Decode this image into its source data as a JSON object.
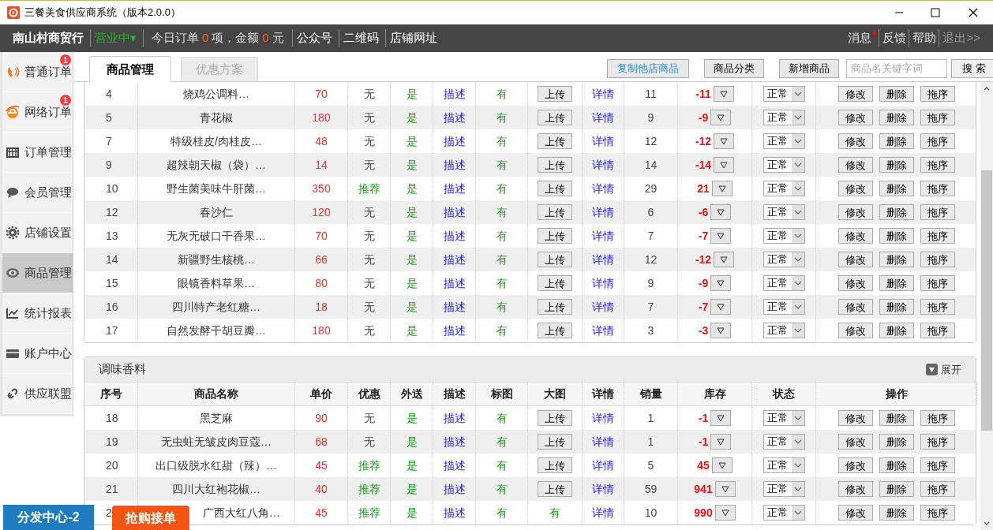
{
  "window": {
    "title": "三餐美食供应商系统（版本2.0.0）"
  },
  "header": {
    "shop": "南山村商贸行",
    "business_status": "营业中▾",
    "stats": [
      {
        "text": "今日订单",
        "kind": "label"
      },
      {
        "text": "0",
        "kind": "number"
      },
      {
        "text": "项，金额",
        "kind": "label"
      },
      {
        "text": "0",
        "kind": "number"
      },
      {
        "text": "元",
        "kind": "label"
      }
    ],
    "links": [
      "公众号",
      "二维码",
      "店铺网址"
    ],
    "right_links": [
      {
        "label": "消息",
        "unread": true,
        "muted": false
      },
      {
        "label": "反馈",
        "unread": false,
        "muted": false
      },
      {
        "label": "帮助",
        "unread": false,
        "muted": false
      },
      {
        "label": "退出>>",
        "unread": false,
        "muted": true
      }
    ]
  },
  "sidebar": {
    "items": [
      {
        "label": "普通订单",
        "badge": "1",
        "selected": false
      },
      {
        "label": "网络订单",
        "badge": "1",
        "selected": false
      },
      {
        "label": "订单管理",
        "selected": false
      },
      {
        "label": "会员管理",
        "selected": false
      },
      {
        "label": "店铺设置",
        "selected": false
      },
      {
        "label": "商品管理",
        "selected": true
      },
      {
        "label": "统计报表",
        "selected": false
      },
      {
        "label": "账户中心",
        "selected": false
      },
      {
        "label": "供应联盟",
        "selected": false
      }
    ]
  },
  "tabs": [
    {
      "label": "商品管理",
      "selected": true
    },
    {
      "label": "优惠方案",
      "selected": false
    }
  ],
  "toolbar": {
    "buttons": [
      {
        "label": "复制他店商品",
        "kind": "highlight"
      },
      {
        "label": "商品分类",
        "kind": "plain"
      },
      {
        "label": "新增商品",
        "kind": "plain"
      }
    ],
    "search": {
      "placeholder": "商品名关键字词"
    },
    "search_button": "搜 索"
  },
  "sections": [
    {
      "rows": [
        {
          "no": "4",
          "name": "烧鸡公调料…",
          "price": "70",
          "promo": "无",
          "recommended": false,
          "delivery": "是",
          "desc": "描述",
          "title_image": "有",
          "big_image": {
            "kind": "button",
            "label": "上传"
          },
          "detail": "详情",
          "sales": "11",
          "stock": "-11",
          "status": "正常",
          "actions": [
            "修改",
            "删除",
            "拖序"
          ]
        },
        {
          "no": "5",
          "name": "青花椒",
          "price": "180",
          "promo": "无",
          "recommended": false,
          "delivery": "是",
          "desc": "描述",
          "title_image": "有",
          "big_image": {
            "kind": "button",
            "label": "上传"
          },
          "detail": "详情",
          "sales": "9",
          "stock": "-9",
          "status": "正常",
          "actions": [
            "修改",
            "删除",
            "拖序"
          ]
        },
        {
          "no": "7",
          "name": "特级桂皮/肉桂皮…",
          "price": "48",
          "promo": "无",
          "recommended": false,
          "delivery": "是",
          "desc": "描述",
          "title_image": "有",
          "big_image": {
            "kind": "button",
            "label": "上传"
          },
          "detail": "详情",
          "sales": "12",
          "stock": "-12",
          "status": "正常",
          "actions": [
            "修改",
            "删除",
            "拖序"
          ]
        },
        {
          "no": "9",
          "name": "超辣朝天椒（袋）…",
          "price": "14",
          "promo": "无",
          "recommended": false,
          "delivery": "是",
          "desc": "描述",
          "title_image": "有",
          "big_image": {
            "kind": "button",
            "label": "上传"
          },
          "detail": "详情",
          "sales": "14",
          "stock": "-14",
          "status": "正常",
          "actions": [
            "修改",
            "删除",
            "拖序"
          ]
        },
        {
          "no": "10",
          "name": "野生菌美味牛肝菌…",
          "price": "350",
          "promo": "推荐",
          "recommended": true,
          "delivery": "是",
          "desc": "描述",
          "title_image": "有",
          "big_image": {
            "kind": "button",
            "label": "上传"
          },
          "detail": "详情",
          "sales": "29",
          "stock": "21",
          "status": "正常",
          "actions": [
            "修改",
            "删除",
            "拖序"
          ]
        },
        {
          "no": "12",
          "name": "春沙仁",
          "price": "120",
          "promo": "无",
          "recommended": false,
          "delivery": "是",
          "desc": "描述",
          "title_image": "有",
          "big_image": {
            "kind": "button",
            "label": "上传"
          },
          "detail": "详情",
          "sales": "6",
          "stock": "-6",
          "status": "正常",
          "actions": [
            "修改",
            "删除",
            "拖序"
          ]
        },
        {
          "no": "13",
          "name": "无灰无破口干香果…",
          "price": "70",
          "promo": "无",
          "recommended": false,
          "delivery": "是",
          "desc": "描述",
          "title_image": "有",
          "big_image": {
            "kind": "button",
            "label": "上传"
          },
          "detail": "详情",
          "sales": "7",
          "stock": "-7",
          "status": "正常",
          "actions": [
            "修改",
            "删除",
            "拖序"
          ]
        },
        {
          "no": "14",
          "name": "新疆野生核桃…",
          "price": "66",
          "promo": "无",
          "recommended": false,
          "delivery": "是",
          "desc": "描述",
          "title_image": "有",
          "big_image": {
            "kind": "button",
            "label": "上传"
          },
          "detail": "详情",
          "sales": "12",
          "stock": "-12",
          "status": "正常",
          "actions": [
            "修改",
            "删除",
            "拖序"
          ]
        },
        {
          "no": "15",
          "name": "眼镜香料草果…",
          "price": "80",
          "promo": "无",
          "recommended": false,
          "delivery": "是",
          "desc": "描述",
          "title_image": "有",
          "big_image": {
            "kind": "button",
            "label": "上传"
          },
          "detail": "详情",
          "sales": "9",
          "stock": "-9",
          "status": "正常",
          "actions": [
            "修改",
            "删除",
            "拖序"
          ]
        },
        {
          "no": "16",
          "name": "四川特产老红糖…",
          "price": "18",
          "promo": "无",
          "recommended": false,
          "delivery": "是",
          "desc": "描述",
          "title_image": "有",
          "big_image": {
            "kind": "button",
            "label": "上传"
          },
          "detail": "详情",
          "sales": "7",
          "stock": "-7",
          "status": "正常",
          "actions": [
            "修改",
            "删除",
            "拖序"
          ]
        },
        {
          "no": "17",
          "name": "自然发酵干胡豆瓣…",
          "price": "180",
          "promo": "无",
          "recommended": false,
          "delivery": "是",
          "desc": "描述",
          "title_image": "有",
          "big_image": {
            "kind": "button",
            "label": "上传"
          },
          "detail": "详情",
          "sales": "3",
          "stock": "-3",
          "status": "正常",
          "actions": [
            "修改",
            "删除",
            "拖序"
          ]
        }
      ]
    },
    {
      "title": "调味香料",
      "toggle": "展开",
      "columns": [
        "序号",
        "商品名称",
        "单价",
        "优惠",
        "外送",
        "描述",
        "标图",
        "大图",
        "详情",
        "销量",
        "库存",
        "状态",
        "操作"
      ],
      "rows": [
        {
          "no": "18",
          "name": "黑芝麻",
          "price": "90",
          "promo": "无",
          "recommended": false,
          "delivery": "是",
          "desc": "描述",
          "title_image": "有",
          "big_image": {
            "kind": "button",
            "label": "上传"
          },
          "detail": "详情",
          "sales": "1",
          "stock": "-1",
          "status": "正常",
          "actions": [
            "修改",
            "删除",
            "拖序"
          ]
        },
        {
          "no": "19",
          "name": "无虫蛀无皱皮肉豆蔻…",
          "price": "68",
          "promo": "无",
          "recommended": false,
          "delivery": "是",
          "desc": "描述",
          "title_image": "有",
          "big_image": {
            "kind": "button",
            "label": "上传"
          },
          "detail": "详情",
          "sales": "1",
          "stock": "-1",
          "status": "正常",
          "actions": [
            "修改",
            "删除",
            "拖序"
          ]
        },
        {
          "no": "20",
          "name": "出口级脱水红甜（辣）…",
          "price": "45",
          "promo": "推荐",
          "recommended": true,
          "delivery": "是",
          "desc": "描述",
          "title_image": "有",
          "big_image": {
            "kind": "button",
            "label": "上传"
          },
          "detail": "详情",
          "sales": "5",
          "stock": "45",
          "status": "正常",
          "actions": [
            "修改",
            "删除",
            "拖序"
          ]
        },
        {
          "no": "21",
          "name": "四川大红袍花椒…",
          "price": "40",
          "promo": "推荐",
          "recommended": true,
          "delivery": "是",
          "desc": "描述",
          "title_image": "有",
          "big_image": {
            "kind": "button",
            "label": "上传"
          },
          "detail": "详情",
          "sales": "59",
          "stock": "941",
          "status": "正常",
          "actions": [
            "修改",
            "删除",
            "拖序"
          ]
        },
        {
          "no": "2",
          "name": "广西大红八角…",
          "price": "45",
          "promo": "推荐",
          "recommended": true,
          "delivery": "是",
          "desc": "描述",
          "title_image": "有",
          "big_image": {
            "kind": "text",
            "label": "有"
          },
          "detail": "详情",
          "sales": "10",
          "stock": "990",
          "status": "正常",
          "actions": [
            "修改",
            "删除",
            "拖序"
          ]
        }
      ]
    }
  ],
  "floating_buttons": [
    {
      "label": "分发中心-2",
      "kind": "primary"
    },
    {
      "label": "抢购接单",
      "kind": "accent"
    }
  ]
}
